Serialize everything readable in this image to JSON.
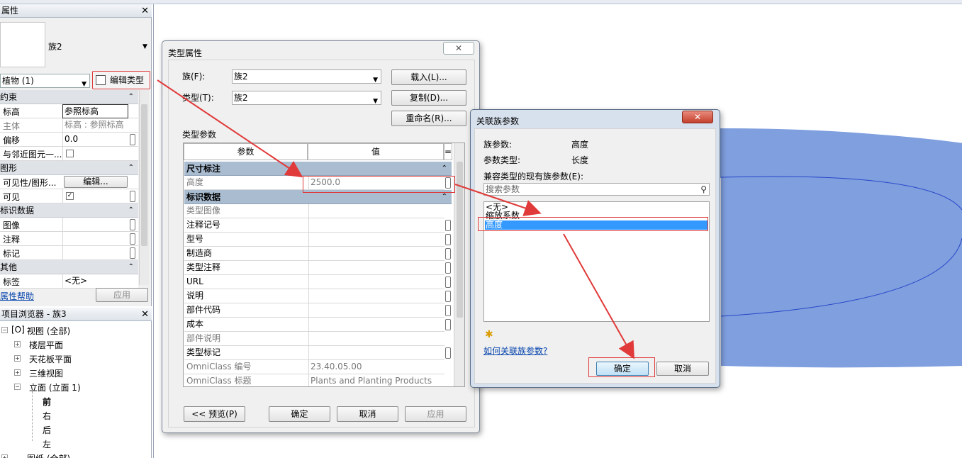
{
  "properties_panel": {
    "title": "属性",
    "family_name": "族2",
    "category_select": "植物 (1)",
    "edit_type_label": "编辑类型",
    "groups": [
      {
        "label": "约束",
        "rows": [
          {
            "key": "标高",
            "value": "参照标高"
          },
          {
            "key": "主体",
            "value": "标高 : 参照标高"
          },
          {
            "key": "偏移",
            "value": "0.0"
          },
          {
            "key": "与邻近图元一...",
            "value": ""
          }
        ]
      },
      {
        "label": "图形",
        "rows": [
          {
            "key": "可见性/图形...",
            "value": "编辑..."
          },
          {
            "key": "可见",
            "value": ""
          }
        ]
      },
      {
        "label": "标识数据",
        "rows": [
          {
            "key": "图像",
            "value": ""
          },
          {
            "key": "注释",
            "value": ""
          },
          {
            "key": "标记",
            "value": ""
          }
        ]
      },
      {
        "label": "其他",
        "rows": [
          {
            "key": "标签",
            "value": "<无>"
          }
        ]
      }
    ],
    "help_link": "属性帮助",
    "apply_label": "应用"
  },
  "project_browser": {
    "title": "项目浏览器 - 族3",
    "root": "视图 (全部)",
    "items": [
      "楼层平面",
      "天花板平面",
      "三维视图",
      "立面 (立面 1)"
    ],
    "elevation_children": [
      "前",
      "右",
      "后",
      "左"
    ],
    "sheets": "图纸 (全部)"
  },
  "type_properties": {
    "title": "类型属性",
    "family_label": "族(F):",
    "family_value": "族2",
    "type_label": "类型(T):",
    "type_value": "族2",
    "load_button": "载入(L)...",
    "duplicate_button": "复制(D)...",
    "rename_button": "重命名(R)...",
    "params_label": "类型参数",
    "col_param": "参数",
    "col_value": "值",
    "col_equals": "=",
    "group_dimensions": "尺寸标注",
    "height_key": "高度",
    "height_value": "2500.0",
    "group_identity": "标识数据",
    "identity_rows": [
      {
        "key": "类型图像",
        "value": ""
      },
      {
        "key": "注释记号",
        "value": ""
      },
      {
        "key": "型号",
        "value": ""
      },
      {
        "key": "制造商",
        "value": ""
      },
      {
        "key": "类型注释",
        "value": ""
      },
      {
        "key": "URL",
        "value": ""
      },
      {
        "key": "说明",
        "value": ""
      },
      {
        "key": "部件代码",
        "value": ""
      },
      {
        "key": "成本",
        "value": ""
      },
      {
        "key": "部件说明",
        "value": ""
      },
      {
        "key": "类型标记",
        "value": ""
      },
      {
        "key": "OmniClass 编号",
        "value": "23.40.05.00"
      },
      {
        "key": "OmniClass 标题",
        "value": "Plants and Planting Products"
      }
    ],
    "preview_button": "<< 预览(P)",
    "ok_button": "确定",
    "cancel_button": "取消",
    "apply_button": "应用"
  },
  "assoc_dialog": {
    "title": "关联族参数",
    "family_param_label": "族参数:",
    "family_param_value": "高度",
    "param_type_label": "参数类型:",
    "param_type_value": "长度",
    "compatible_label": "兼容类型的现有族参数(E):",
    "search_placeholder": "搜索参数",
    "list_items": [
      "<无>",
      "缩放系数",
      "高度"
    ],
    "help_link": "如何关联族参数?",
    "ok_button": "确定",
    "cancel_button": "取消"
  },
  "colors": {
    "disc_fill": "#7f9fdf",
    "disc_stroke": "#2846c8",
    "selection": "#3399ff",
    "annotation_red": "#e03a3a"
  }
}
